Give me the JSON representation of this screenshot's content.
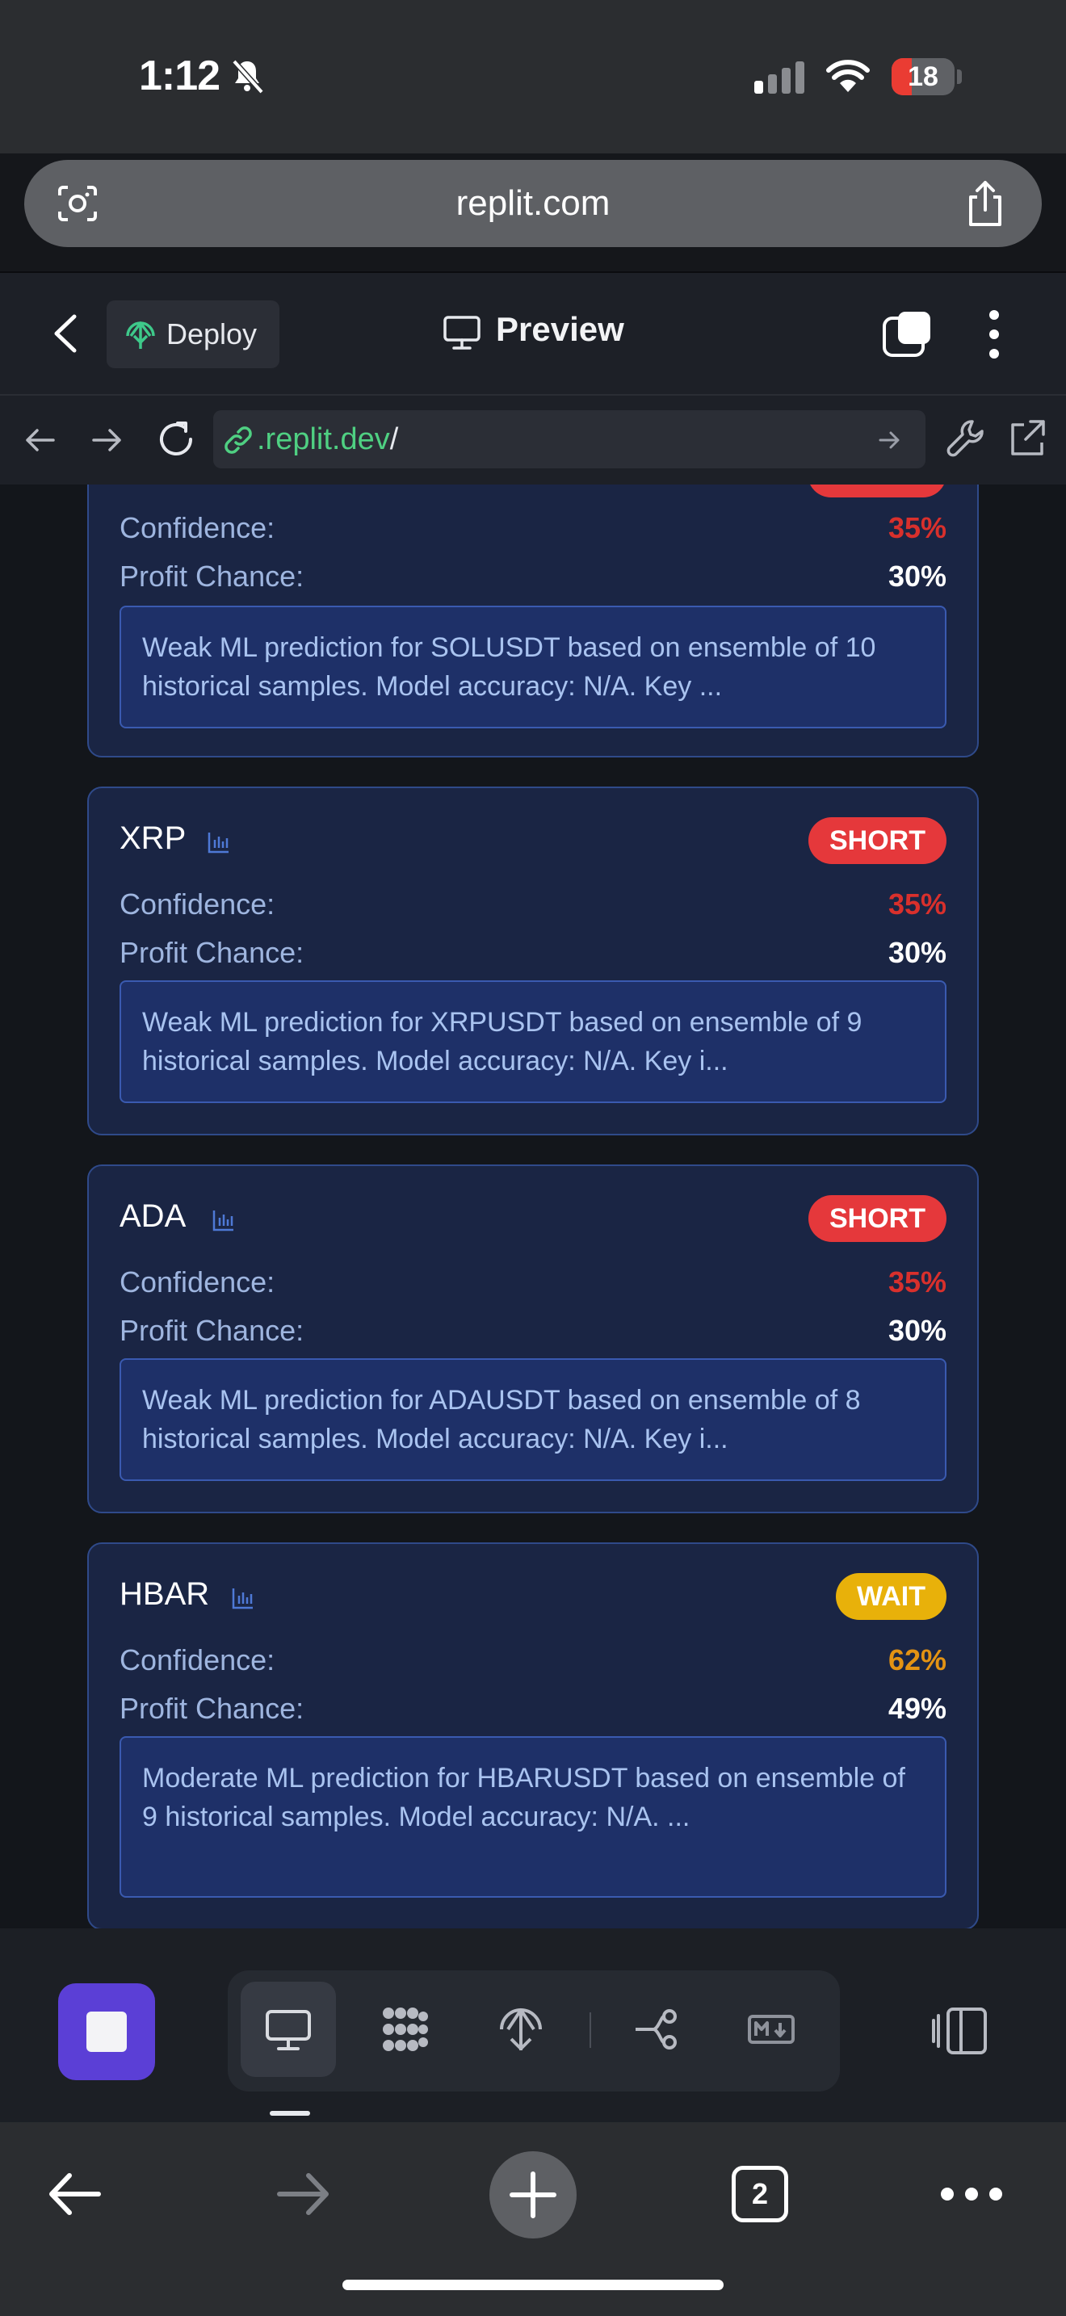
{
  "status_bar": {
    "time": "1:12",
    "battery": "18"
  },
  "browser": {
    "url_display": "replit.com"
  },
  "replit_header": {
    "deploy_label": "Deploy",
    "preview_label": "Preview"
  },
  "webview": {
    "address_host": ".replit.dev",
    "address_path": "/"
  },
  "cards": [
    {
      "confidence_label": "Confidence:",
      "confidence_value": "35%",
      "profit_label": "Profit Chance:",
      "profit_value": "30%",
      "note": "Weak ML prediction for SOLUSDT based on ensemble of 10 historical samples. Model accuracy: N/A. Key ..."
    },
    {
      "symbol": "XRP",
      "signal": "SHORT",
      "confidence_label": "Confidence:",
      "confidence_value": "35%",
      "profit_label": "Profit Chance:",
      "profit_value": "30%",
      "note": "Weak ML prediction for XRPUSDT based on ensemble of 9 historical samples. Model accuracy: N/A. Key i..."
    },
    {
      "symbol": "ADA",
      "signal": "SHORT",
      "confidence_label": "Confidence:",
      "confidence_value": "35%",
      "profit_label": "Profit Chance:",
      "profit_value": "30%",
      "note": "Weak ML prediction for ADAUSDT based on ensemble of 8 historical samples. Model accuracy: N/A. Key i..."
    },
    {
      "symbol": "HBAR",
      "signal": "WAIT",
      "confidence_label": "Confidence:",
      "confidence_value": "62%",
      "profit_label": "Profit Chance:",
      "profit_value": "49%",
      "note": "Moderate ML prediction for HBARUSDT based on ensemble of 9 historical samples. Model accuracy: N/A. ..."
    }
  ],
  "colors": {
    "short": "#e5383b",
    "wait": "#e8b10a",
    "confidence_low": "#d9302c",
    "confidence_mid": "#e39313",
    "accent": "#5b3fd6"
  },
  "replit_toolbar": {
    "icons": [
      "stop-icon",
      "monitor-icon",
      "grid-icon",
      "deploy-icon",
      "git-icon",
      "markdown-icon",
      "panes-icon"
    ]
  },
  "safari_toolbar": {
    "tab_count": "2"
  }
}
